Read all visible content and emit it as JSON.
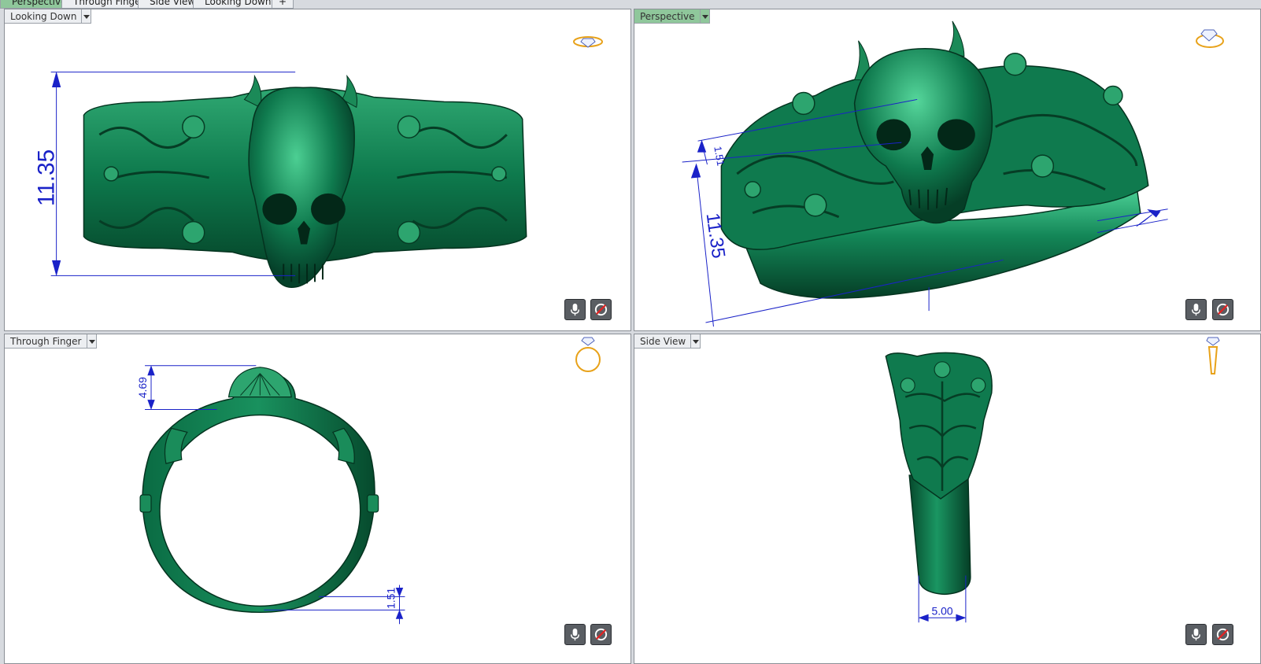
{
  "tabs": [
    {
      "label": "Perspective",
      "active": true
    },
    {
      "label": "Through Finger",
      "active": false
    },
    {
      "label": "Side View",
      "active": false
    },
    {
      "label": "Looking Down",
      "active": false
    },
    {
      "label": "+",
      "active": false
    }
  ],
  "viewports": {
    "top_left": {
      "label": "Looking Down",
      "dimension": "11.35"
    },
    "top_right": {
      "label": "Perspective",
      "dimension": "11.35",
      "dimension_small": "1.51"
    },
    "bottom_left": {
      "label": "Through Finger",
      "dimension_top": "4.69",
      "dimension_bottom": "1.51"
    },
    "bottom_right": {
      "label": "Side View",
      "dimension": "5.00"
    }
  },
  "colors": {
    "model": "#0f7a4e",
    "model_dark": "#064a2d",
    "model_light": "#3fbf85",
    "dimension": "#1a22c8",
    "active_tab": "#8fc79b",
    "ring_icon": "#e8a21a"
  },
  "icons": {
    "mic": "microphone-icon",
    "rotate": "rotate-disabled-icon",
    "ring_top": "ring-top-view-icon",
    "ring_front": "ring-front-view-icon",
    "ring_side": "ring-side-view-icon"
  }
}
